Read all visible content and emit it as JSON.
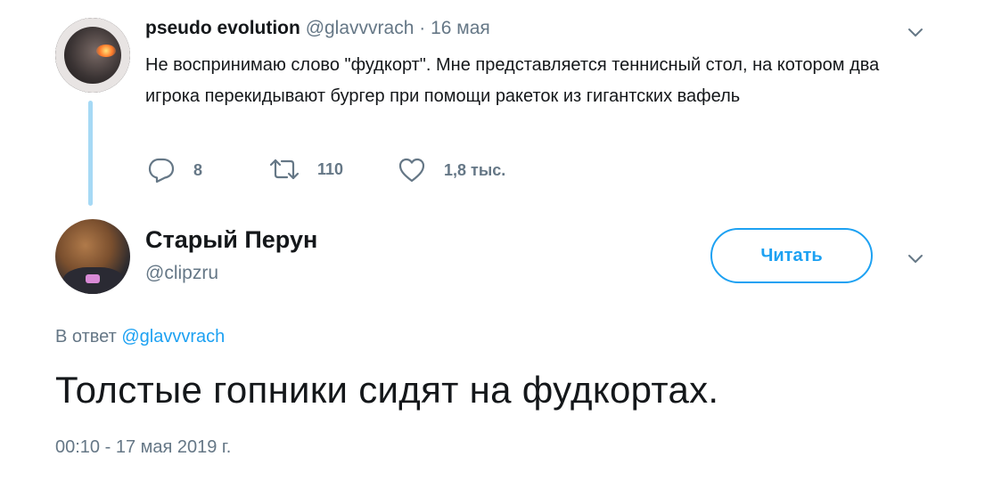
{
  "parent_tweet": {
    "author_name": "pseudo evolution",
    "author_handle": "@glavvvrach",
    "separator": "·",
    "date": "16 мая",
    "text": "Не воспринимаю слово \"фудкорт\". Мне представляется теннисный стол, на котором два игрока перекидывают бургер при помощи ракеток из гигантских вафель",
    "actions": {
      "replies": "8",
      "retweets": "110",
      "likes": "1,8 тыс."
    },
    "icons": {
      "reply": "reply-icon",
      "retweet": "retweet-icon",
      "like": "heart-icon",
      "menu": "chevron-down-icon"
    }
  },
  "main_tweet": {
    "author_name": "Старый Перун",
    "author_handle": "@clipzru",
    "follow_label": "Читать",
    "reply_prefix": "В ответ",
    "reply_to_handle": "@glavvvrach",
    "text": "Толстые гопники сидят на фудкортах.",
    "timestamp": "00:10 - 17 мая 2019 г."
  },
  "colors": {
    "accent": "#1da1f2",
    "secondary_text": "#657786",
    "primary_text": "#14171a",
    "thread_line": "#a6d9f5"
  }
}
